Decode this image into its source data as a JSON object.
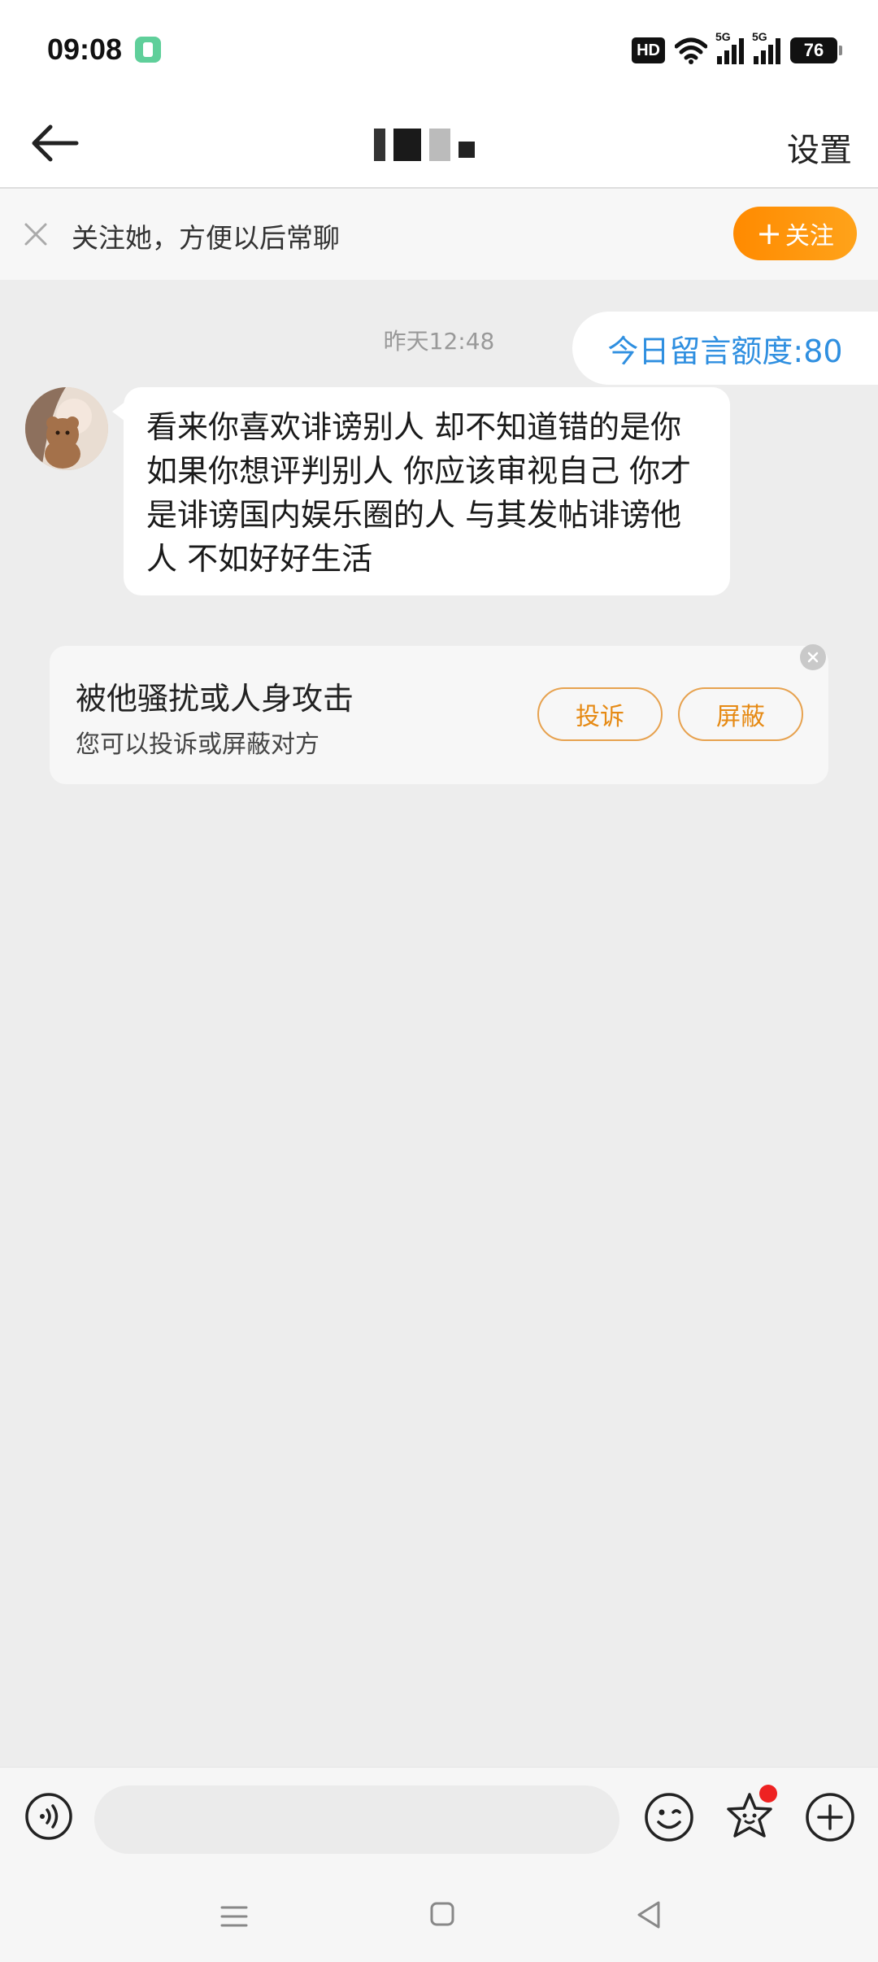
{
  "status_bar": {
    "time": "09:08",
    "hd": "HD",
    "net1": "5G",
    "net2": "5G",
    "battery": "76"
  },
  "header": {
    "title": "",
    "settings_label": "设置"
  },
  "follow_banner": {
    "text": "关注她，方便以后常聊",
    "button_label": "关注"
  },
  "chat": {
    "timestamp": "昨天12:48",
    "quota": "今日留言额度:80",
    "message": "看来你喜欢诽谤别人 却不知道错的是你 如果你想评判别人 你应该审视自己 你才是诽谤国内娱乐圈的人 与其发帖诽谤他人 不如好好生活"
  },
  "report_card": {
    "title": "被他骚扰或人身攻击",
    "subtitle": "您可以投诉或屏蔽对方",
    "report_label": "投诉",
    "block_label": "屏蔽"
  },
  "input_bar": {
    "placeholder": ""
  },
  "colors": {
    "accent_orange": "#ff8a00",
    "link_blue": "#2f8fe0",
    "background": "#ededed",
    "notification_red": "#ee2222"
  },
  "icons": [
    "back-arrow-icon",
    "close-icon",
    "voice-icon",
    "emoji-icon",
    "sticker-icon",
    "plus-icon",
    "menu-icon",
    "home-icon",
    "nav-back-icon"
  ]
}
